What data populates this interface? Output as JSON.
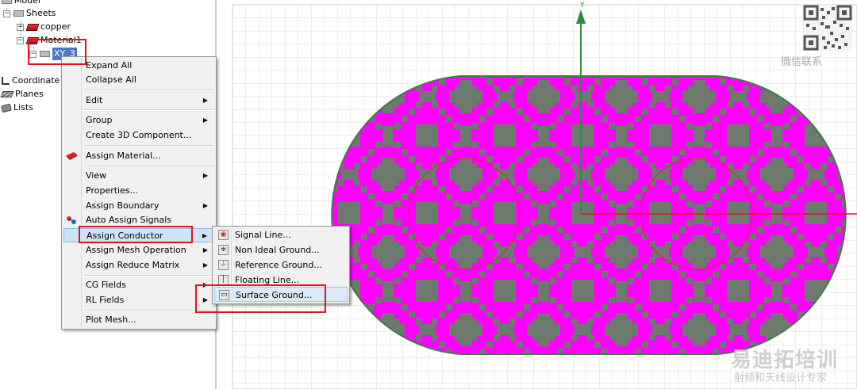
{
  "tree": {
    "root_label": "Model",
    "sheets_label": "Sheets",
    "copper_label": "copper",
    "material_label": "Material1",
    "selected_item_label": "XY_3",
    "coordinate_label": "Coordinate",
    "planes_label": "Planes",
    "lists_label": "Lists",
    "expand_collapsed": "+",
    "expand_open": "−"
  },
  "context_menu": {
    "items": [
      {
        "label": "Expand All"
      },
      {
        "label": "Collapse All"
      },
      {
        "label": "Edit",
        "submenu": true
      },
      {
        "label": "Group",
        "submenu": true
      },
      {
        "label": "Create 3D Component..."
      },
      {
        "label": "Assign Material...",
        "icon": "material-icon"
      },
      {
        "label": "View",
        "submenu": true
      },
      {
        "label": "Properties..."
      },
      {
        "label": "Assign Boundary",
        "submenu": true
      },
      {
        "label": "Auto Assign Signals",
        "icon": "auto-assign-icon"
      },
      {
        "label": "Assign Conductor",
        "submenu": true,
        "highlighted": true
      },
      {
        "label": "Assign Mesh Operation",
        "submenu": true
      },
      {
        "label": "Assign Reduce Matrix",
        "submenu": true
      },
      {
        "label": "CG Fields",
        "submenu": true
      },
      {
        "label": "RL Fields",
        "submenu": true
      },
      {
        "label": "Plot Mesh..."
      }
    ],
    "submenu_arrow": "▶"
  },
  "conductor_submenu": {
    "items": [
      {
        "label": "Signal Line...",
        "icon": "signal-line-icon",
        "glyph": "◉"
      },
      {
        "label": "Non Ideal Ground...",
        "icon": "non-ideal-ground-icon",
        "glyph": "≑"
      },
      {
        "label": "Reference Ground...",
        "icon": "reference-ground-icon",
        "glyph": "⏚"
      },
      {
        "label": "Floating Line...",
        "icon": "floating-line-icon",
        "glyph": "┆"
      },
      {
        "label": "Surface Ground...",
        "icon": "surface-ground-icon",
        "glyph": "▭",
        "highlighted": true
      }
    ]
  },
  "viewport": {
    "axis_label_y": "Y",
    "colors": {
      "shape_fill": "#ff00ff",
      "pattern": "#6e7b6e",
      "outline": "#3f7a45",
      "axis": "#2e8b40",
      "red_axis": "#e01818",
      "grid": "#d6d6d6"
    }
  },
  "watermarks": {
    "wechat": "微信联系",
    "brand_cn": "易迪拓培训",
    "tagline_cn": "射频和天线设计专家"
  }
}
